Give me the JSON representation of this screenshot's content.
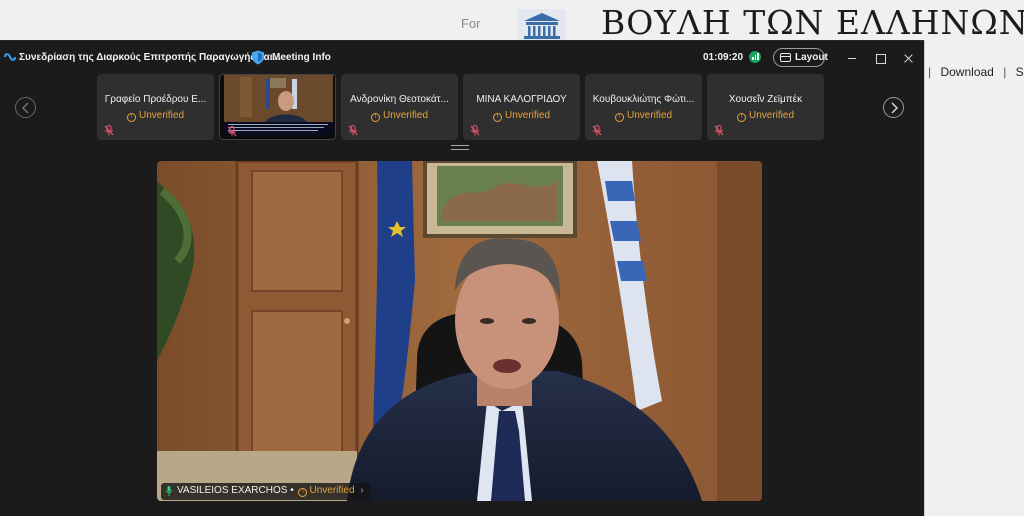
{
  "site": {
    "for_text": "For",
    "title": "ΒΟΥΛΗ ΤΩΝ ΕΛΛΗΝΩΝ",
    "links": [
      "Download",
      "Sign"
    ]
  },
  "window": {
    "meeting_title": "Συνεδρίαση της Διαρκούς Επιτροπής Παραγωγής και...",
    "meeting_info": "Meeting Info",
    "timer": "01:09:20",
    "layout_label": "Layout"
  },
  "participants": [
    {
      "name": "Γραφείο Προέδρου Ε...",
      "status": "Unverified",
      "has_video": false
    },
    {
      "name": "",
      "status": "",
      "has_video": true
    },
    {
      "name": "Ανδρονίκη Θεοτοκάτ...",
      "status": "Unverified",
      "has_video": false
    },
    {
      "name": "ΜΙΝΑ ΚΑΛΟΓΡΙΔΟΥ",
      "status": "Unverified",
      "has_video": false
    },
    {
      "name": "Κουβουκλιώτης Φώτι...",
      "status": "Unverified",
      "has_video": false
    },
    {
      "name": "Χουσεΐν Ζεϊμπέκ",
      "status": "Unverified",
      "has_video": false
    }
  ],
  "speaker": {
    "name": "VASILEIOS EXARCHOS",
    "status": "Unverified",
    "separator": "•",
    "more": "›"
  },
  "icons": {
    "app": "webex-icon",
    "info": "shield-icon",
    "signal": "connection-signal-icon",
    "layout": "layout-icon",
    "mic_off": "mic-muted-icon",
    "mic_on": "mic-icon",
    "prev": "chevron-left-icon",
    "next": "chevron-right-icon"
  },
  "colors": {
    "window_bg": "#1b1b1b",
    "tile_bg": "#2f2f2f",
    "unverified": "#e8a33a",
    "signal": "#1aa260",
    "mic_muted": "#e0566a"
  }
}
